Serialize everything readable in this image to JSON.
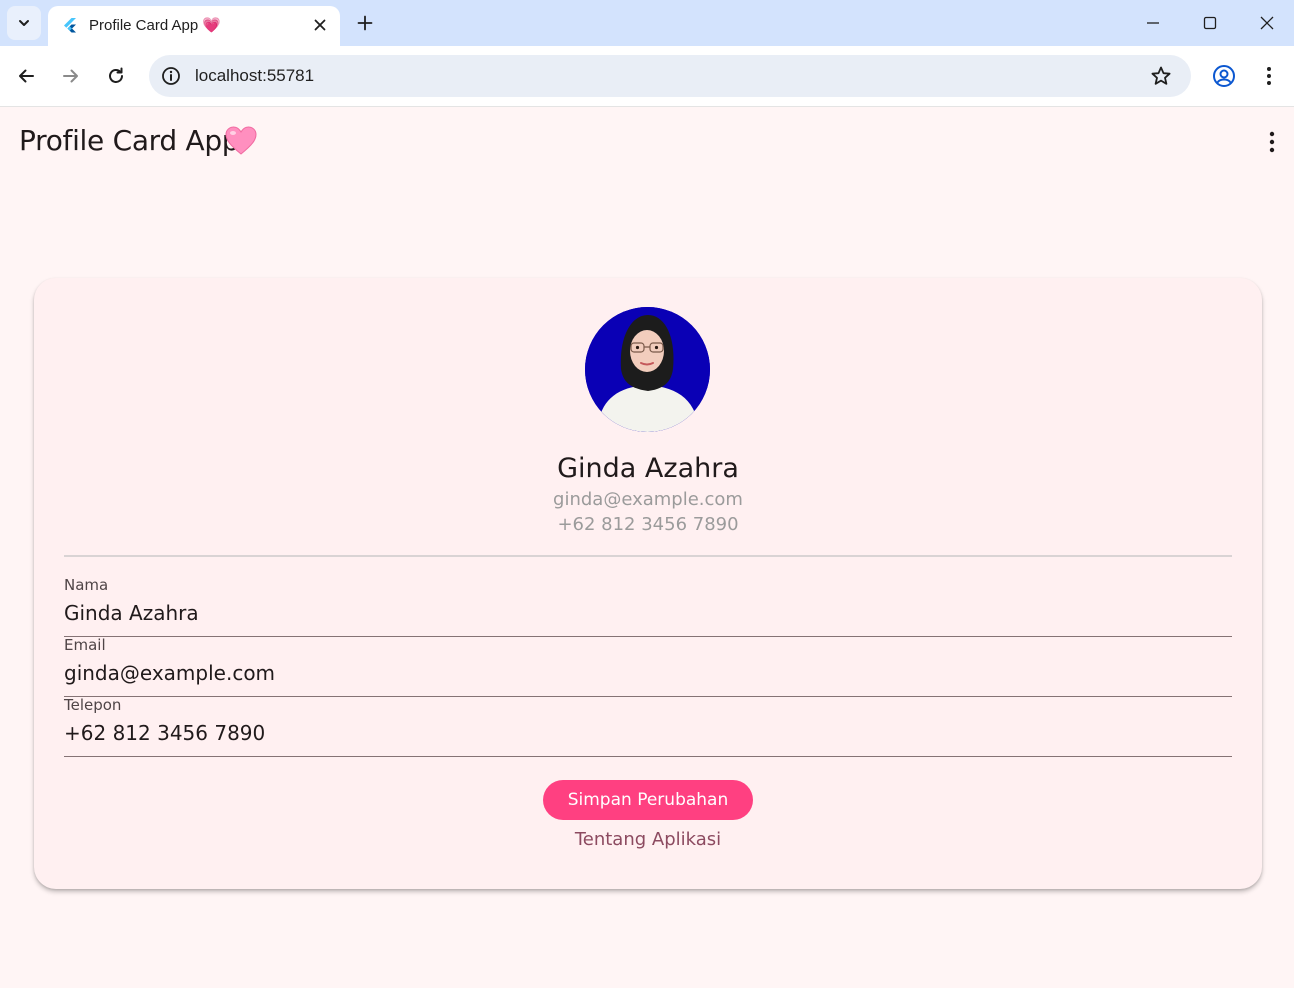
{
  "browser": {
    "tab_title": "Profile Card App 💗",
    "url": "localhost:55781"
  },
  "app": {
    "title": "Profile Card App"
  },
  "profile": {
    "name": "Ginda Azahra",
    "email": "ginda@example.com",
    "phone": "+62 812 3456 7890"
  },
  "form": {
    "fields": [
      {
        "label": "Nama",
        "value": "Ginda Azahra"
      },
      {
        "label": "Email",
        "value": "ginda@example.com"
      },
      {
        "label": "Telepon",
        "value": "+62 812 3456 7890"
      }
    ],
    "save_label": "Simpan Perubahan",
    "about_label": "Tentang Aplikasi"
  },
  "colors": {
    "accent": "#ff4081",
    "page_bg": "#fff5f5",
    "card_bg": "#fff0f1",
    "avatar_bg": "#0a00b5",
    "heart": "#ff8fbf"
  }
}
